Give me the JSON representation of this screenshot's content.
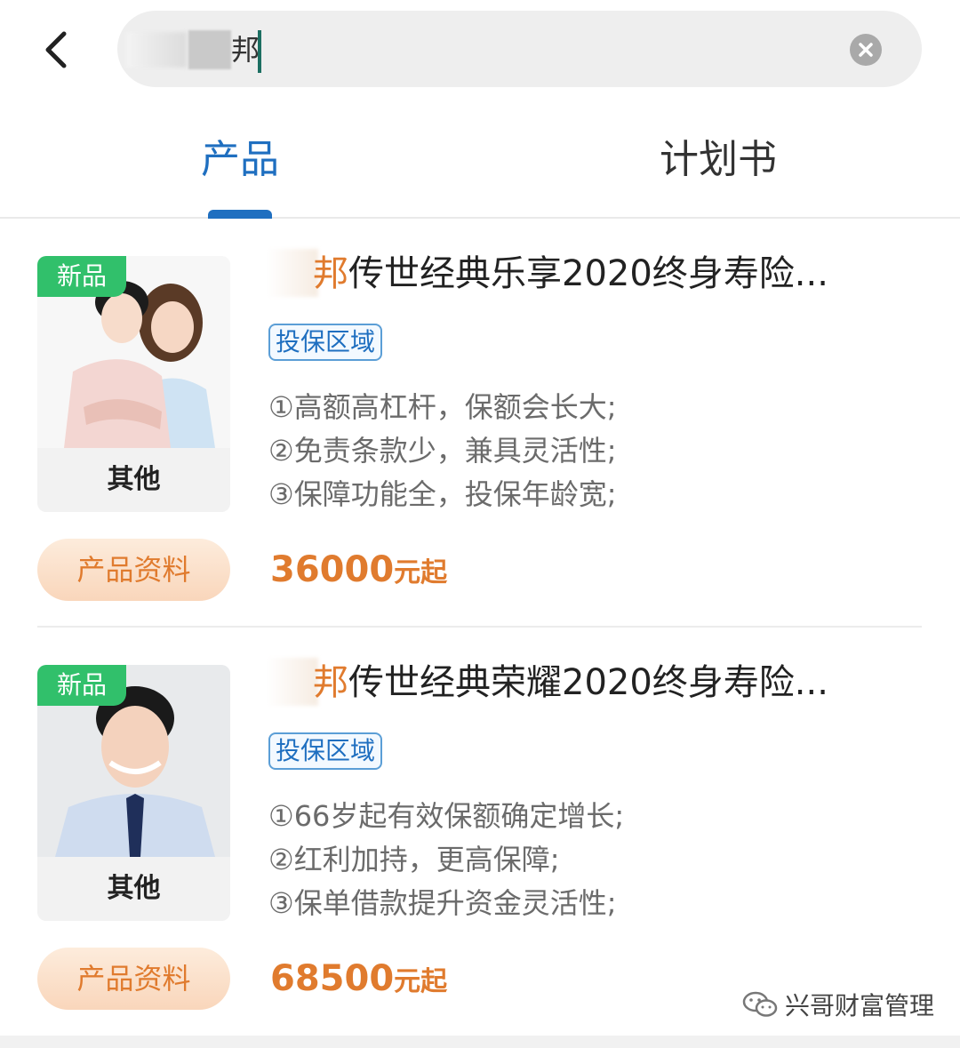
{
  "search": {
    "value": "邦",
    "back_icon": "chevron-left-icon",
    "clear_icon": "close-icon"
  },
  "tabs": [
    {
      "label": "产品",
      "active": true
    },
    {
      "label": "计划书",
      "active": false
    }
  ],
  "products": [
    {
      "badge": "新品",
      "category": "其他",
      "title_prefix": "邦",
      "title_rest": "传世经典乐享2020终身寿险...",
      "region_tag": "投保区域",
      "features": [
        "①高额高杠杆，保额会长大;",
        "②免责条款少，兼具灵活性;",
        "③保障功能全，投保年龄宽;"
      ],
      "doc_button": "产品资料",
      "price_value": "36000",
      "price_unit": "元起"
    },
    {
      "badge": "新品",
      "category": "其他",
      "title_prefix": "邦",
      "title_rest": "传世经典荣耀2020终身寿险...",
      "region_tag": "投保区域",
      "features": [
        "①66岁起有效保额确定增长;",
        "②红利加持，更高保障;",
        "③保单借款提升资金灵活性;"
      ],
      "doc_button": "产品资料",
      "price_value": "68500",
      "price_unit": "元起"
    }
  ],
  "watermark": {
    "text": "兴哥财富管理",
    "icon": "wechat-icon"
  },
  "colors": {
    "accent_blue": "#1f6fc0",
    "accent_orange": "#e07b2e",
    "new_badge": "#31c06b"
  }
}
